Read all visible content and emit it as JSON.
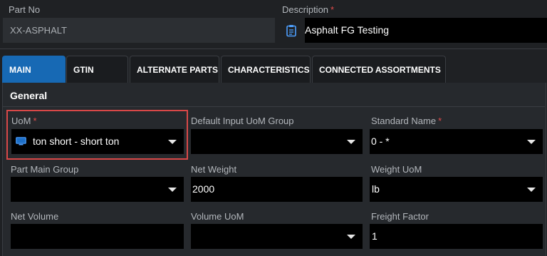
{
  "header": {
    "part_no": {
      "label": "Part No",
      "value": "XX-ASPHALT"
    },
    "description": {
      "label": "Description",
      "required_mark": "*",
      "value": "Asphalt FG Testing",
      "icon": "clipboard-icon"
    }
  },
  "tabs": [
    {
      "label": "MAIN",
      "active": true
    },
    {
      "label": "GTIN"
    },
    {
      "label": "ALTERNATE PARTS"
    },
    {
      "label": "CHARACTERISTICS"
    },
    {
      "label": "CONNECTED ASSORTMENTS"
    }
  ],
  "section": {
    "title": "General"
  },
  "fields": {
    "uom": {
      "label": "UoM",
      "required_mark": "*",
      "value": "ton short - short ton",
      "icon": "monitor-icon",
      "highlight_color": "#d94848"
    },
    "default_input_uom_group": {
      "label": "Default Input UoM Group",
      "value": ""
    },
    "standard_name": {
      "label": "Standard Name",
      "required_mark": "*",
      "value": "0 - *"
    },
    "part_main_group": {
      "label": "Part Main Group",
      "value": ""
    },
    "net_weight": {
      "label": "Net Weight",
      "value": "2000"
    },
    "weight_uom": {
      "label": "Weight UoM",
      "value": "lb"
    },
    "net_volume": {
      "label": "Net Volume",
      "value": ""
    },
    "volume_uom": {
      "label": "Volume UoM",
      "value": ""
    },
    "freight_factor": {
      "label": "Freight Factor",
      "value": "1"
    }
  },
  "colors": {
    "accent": "#1769b4",
    "background": "#1f2124",
    "panel": "#26292d",
    "field": "#000000"
  }
}
